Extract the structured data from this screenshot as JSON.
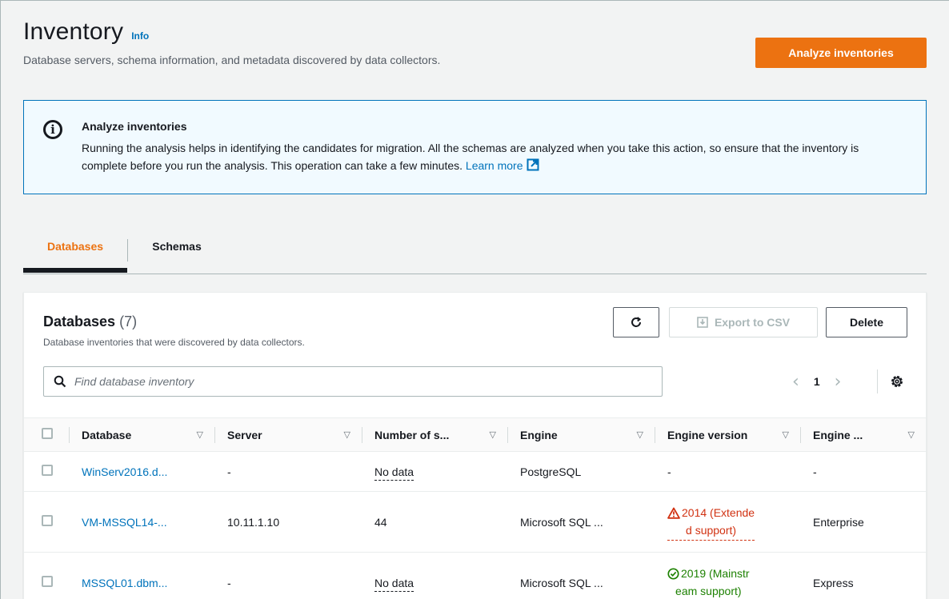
{
  "header": {
    "title": "Inventory",
    "info_link": "Info",
    "subtitle": "Database servers, schema information, and metadata discovered by data collectors.",
    "primary_button": "Analyze inventories"
  },
  "alert": {
    "title": "Analyze inventories",
    "body": "Running the analysis helps in identifying the candidates for migration. All the schemas are analyzed when you take this action, so ensure that the inventory is complete before you run the analysis. This operation can take a few minutes.",
    "link": "Learn more",
    "icon": "info-circle-icon"
  },
  "tabs": [
    {
      "label": "Databases",
      "active": true
    },
    {
      "label": "Schemas",
      "active": false
    }
  ],
  "panel": {
    "title": "Databases",
    "count": "(7)",
    "description": "Database inventories that were discovered by data collectors.",
    "export_label": "Export to CSV",
    "delete_label": "Delete",
    "search_placeholder": "Find database inventory",
    "current_page": "1"
  },
  "table": {
    "columns": [
      "Database",
      "Server",
      "Number of s...",
      "Engine",
      "Engine version",
      "Engine ..."
    ],
    "rows": [
      {
        "database": "WinServ2016.d...",
        "server": "-",
        "schemas": "No data",
        "engine": "PostgreSQL",
        "version_line1": "-",
        "version_line2": "",
        "version_status": "none",
        "edition": "-"
      },
      {
        "database": "VM-MSSQL14-...",
        "server": "10.11.1.10",
        "schemas": "44",
        "engine": "Microsoft SQL ...",
        "version_line1": "2014 (Extende",
        "version_line2": "d support)",
        "version_status": "warning",
        "edition": "Enterprise"
      },
      {
        "database": "MSSQL01.dbm...",
        "server": "-",
        "schemas": "No data",
        "engine": "Microsoft SQL ...",
        "version_line1": "2019 (Mainstr",
        "version_line2": "eam support)",
        "version_status": "success",
        "edition": "Express"
      }
    ]
  },
  "colors": {
    "accent": "#ec7211",
    "link": "#0073bb",
    "warning": "#d13212",
    "success": "#1d8102",
    "info_bg": "#f1faff"
  }
}
